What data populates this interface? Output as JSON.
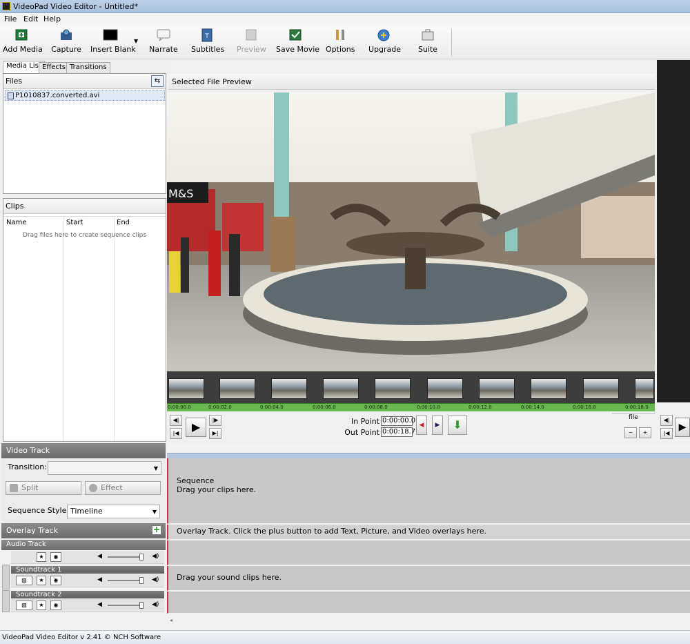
{
  "window": {
    "title": "VideoPad Video Editor - Untitled*"
  },
  "menu": [
    "File",
    "Edit",
    "Help"
  ],
  "toolbar": {
    "buttons": [
      {
        "label": "Add Media",
        "icon": "add-media-icon",
        "enabled": true
      },
      {
        "label": "Capture",
        "icon": "capture-icon",
        "enabled": true
      },
      {
        "label": "Insert Blank",
        "icon": "insert-blank-icon",
        "enabled": true
      },
      {
        "label": "Narrate",
        "icon": "narrate-icon",
        "enabled": true
      },
      {
        "label": "Subtitles",
        "icon": "subtitles-icon",
        "enabled": true
      },
      {
        "label": "Preview",
        "icon": "preview-icon",
        "enabled": false
      },
      {
        "label": "Save Movie",
        "icon": "save-movie-icon",
        "enabled": true
      },
      {
        "label": "Options",
        "icon": "options-icon",
        "enabled": true
      },
      {
        "label": "Upgrade",
        "icon": "upgrade-icon",
        "enabled": true
      },
      {
        "label": "Suite",
        "icon": "suite-icon",
        "enabled": true
      }
    ]
  },
  "tabs": [
    "Media List",
    "Effects",
    "Transitions"
  ],
  "files": {
    "header": "Files",
    "items": [
      "P1010837.converted.avi"
    ]
  },
  "clips": {
    "header": "Clips",
    "columns": [
      "Name",
      "Start",
      "End"
    ],
    "empty": "Drag files here to create sequence clips"
  },
  "preview": {
    "header": "Selected File Preview",
    "ruler": [
      "0:00:00.0",
      "0:00:02.0",
      "0:00:04.0",
      "0:00:06.0",
      "0:00:08.0",
      "0:00:10.0",
      "0:00:12.0",
      "0:00:14.0",
      "0:00:16.0",
      "0:00:18.0"
    ],
    "in_label": "In Point",
    "in_value": "0:00:00.0",
    "out_label": "Out Point",
    "out_value": "0:00:18.7",
    "file_tag": "file"
  },
  "video_track": {
    "header": "Video Track",
    "transition_label": "Transition:",
    "transition_value": "",
    "split": "Split",
    "effect": "Effect",
    "seq_style_label": "Sequence Style:",
    "seq_style_value": "Timeline"
  },
  "overlay_track": {
    "header": "Overlay Track"
  },
  "audio_track": {
    "header": "Audio Track",
    "soundtracks": [
      "Soundtrack 1",
      "Soundtrack 2"
    ]
  },
  "sequence": {
    "title": "Sequence",
    "hint": "Drag your clips here.",
    "overlay_hint": "Overlay Track. Click the plus button to add Text, Picture, and Video overlays here.",
    "sound_hint": "Drag your sound clips here."
  },
  "status": "VideoPad Video Editor v 2.41 © NCH Software",
  "colors": {
    "timeline_ruler": "#6bb74f",
    "track_header": "#7a7a7a",
    "accent_red": "#c23a3a"
  }
}
